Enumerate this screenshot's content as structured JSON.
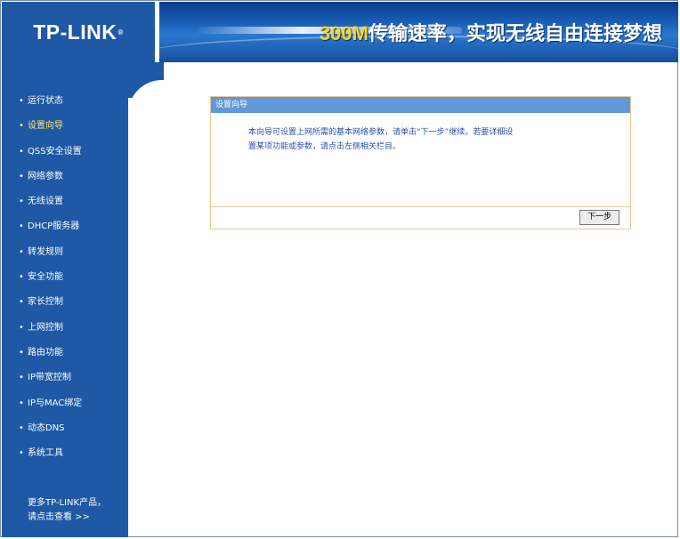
{
  "header": {
    "logo_text": "TP-LINK",
    "slogan_highlight": "300M",
    "slogan_text": "传输速率，实现无线自由连接梦想"
  },
  "sidebar": {
    "items": [
      {
        "label": "运行状态"
      },
      {
        "label": "设置向导"
      },
      {
        "label": "QSS安全设置"
      },
      {
        "label": "网络参数"
      },
      {
        "label": "无线设置"
      },
      {
        "label": "DHCP服务器"
      },
      {
        "label": "转发规则"
      },
      {
        "label": "安全功能"
      },
      {
        "label": "家长控制"
      },
      {
        "label": "上网控制"
      },
      {
        "label": "路由功能"
      },
      {
        "label": "IP带宽控制"
      },
      {
        "label": "IP与MAC绑定"
      },
      {
        "label": "动态DNS"
      },
      {
        "label": "系统工具"
      }
    ],
    "more_line1": "更多TP-LINK产品，",
    "more_line2": "请点击查看 >>"
  },
  "wizard": {
    "title": "设置向导",
    "desc_line1": "本向导可设置上网所需的基本网络参数，请单击“下一步”继续。若要详细设",
    "desc_line2": "置某项功能或参数，请点击左侧相关栏目。",
    "next_label": "下一步"
  },
  "colors": {
    "sidebar_bg": "#1f58a5",
    "panel_title_bg": "#5f98db",
    "panel_border": "#f1c68f",
    "body_text": "#2d4fae"
  }
}
